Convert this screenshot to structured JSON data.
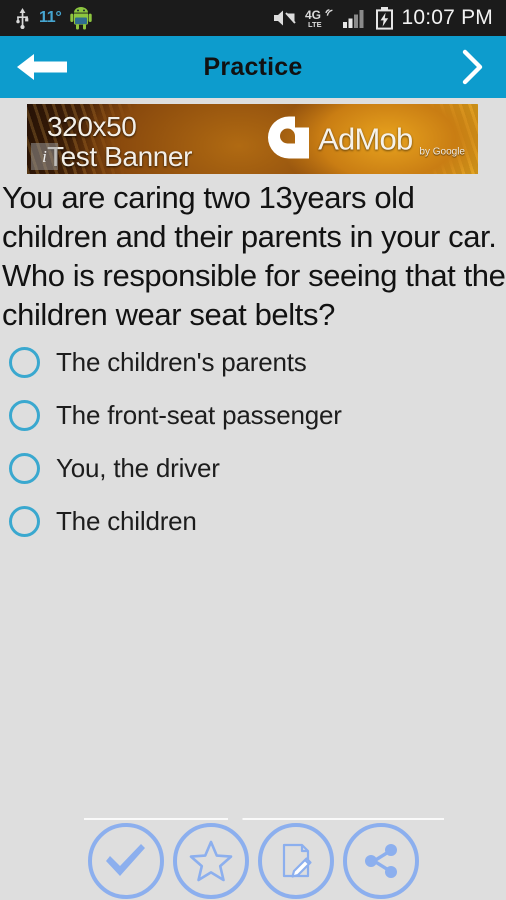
{
  "status_bar": {
    "usb_icon": "usb-icon",
    "temperature": "11°",
    "android_icon": "android-robot-icon",
    "mute_icon": "mute-icon",
    "network": "4G",
    "network_sub": "LTE",
    "signal_icon": "signal-bars-icon",
    "battery_icon": "battery-charging-icon",
    "time": "10:07 PM"
  },
  "title_bar": {
    "title": "Practice",
    "back_icon": "arrow-left-icon",
    "forward_icon": "chevron-right-icon",
    "background_color": "#0d9ccd"
  },
  "ad": {
    "line1": "320x50",
    "line2": "Test Banner",
    "info_badge": "i",
    "brand": "AdMob",
    "brand_by": "by Google",
    "logo_icon": "admob-logo-icon"
  },
  "question": {
    "text": "You are caring two 13years old children and their parents in your car. Who is responsible for seeing that the children wear seat belts?"
  },
  "options": [
    {
      "label": "The children's parents",
      "selected": false
    },
    {
      "label": "The front-seat passenger",
      "selected": false
    },
    {
      "label": "You, the driver",
      "selected": false
    },
    {
      "label": "The children",
      "selected": false
    }
  ],
  "toolbar": {
    "buttons": [
      {
        "name": "answer-check-button",
        "icon": "check-icon"
      },
      {
        "name": "favorite-button",
        "icon": "star-icon"
      },
      {
        "name": "note-button",
        "icon": "note-edit-icon"
      },
      {
        "name": "share-button",
        "icon": "share-icon"
      }
    ],
    "accent_color": "#8cafee"
  },
  "colors": {
    "page_background": "#dedede",
    "status_bar": "#1b1b1b",
    "accent_blue": "#0d9ccd",
    "radio_blue": "#3aa8cf"
  }
}
